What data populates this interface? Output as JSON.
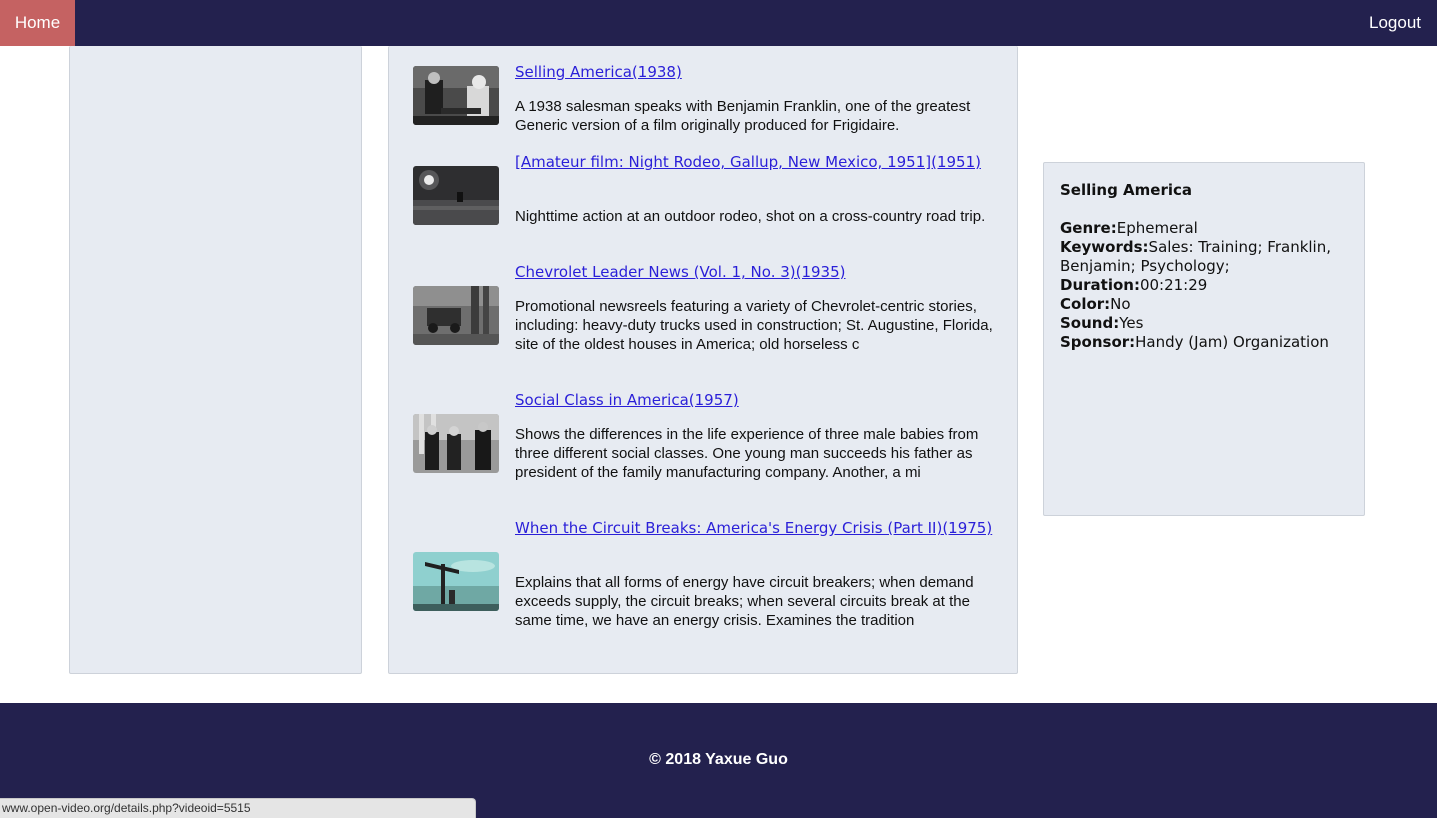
{
  "nav": {
    "home_label": "Home",
    "logout_label": "Logout"
  },
  "videos": [
    {
      "title": "Selling America(1938)",
      "description": "A 1938 salesman speaks with Benjamin Franklin, one of the greatest Generic version of a film originally produced for Frigidaire."
    },
    {
      "title": "[Amateur film: Night Rodeo, Gallup, New Mexico, 1951](1951)",
      "description": "Nighttime action at an outdoor rodeo, shot on a cross-country road trip."
    },
    {
      "title": "Chevrolet Leader News (Vol. 1, No. 3)(1935)",
      "description": "Promotional newsreels featuring a variety of Chevrolet-centric stories, including: heavy-duty trucks used in construction; St. Augustine, Florida, site of the oldest houses in America; old horseless c"
    },
    {
      "title": "Social Class in America(1957)",
      "description": "Shows the differences in the life experience of three male babies from three different social classes. One young man succeeds his father as president of the family manufacturing company. Another, a mi"
    },
    {
      "title": "When the Circuit Breaks: America's Energy Crisis (Part II)(1975)",
      "description": "Explains that all forms of energy have circuit breakers; when demand exceeds supply, the circuit breaks; when several circuits break at the same time, we have an energy crisis. Examines the tradition"
    }
  ],
  "details": {
    "title": "Selling America",
    "genre_label": "Genre:",
    "genre": "Ephemeral",
    "keywords_label": "Keywords:",
    "keywords": "Sales: Training; Franklin, Benjamin; Psychology;",
    "duration_label": "Duration:",
    "duration": "00:21:29",
    "color_label": "Color:",
    "color": "No",
    "sound_label": "Sound:",
    "sound": "Yes",
    "sponsor_label": "Sponsor:",
    "sponsor": "Handy (Jam) Organization"
  },
  "footer": {
    "text": "© 2018 Yaxue Guo"
  },
  "statusbar": {
    "url": "www.open-video.org/details.php?videoid=5515"
  },
  "colors": {
    "nav_bg": "#23214e",
    "home_bg": "#c56262",
    "panel_bg": "#e7ebf2",
    "link": "#2a1fd8"
  }
}
